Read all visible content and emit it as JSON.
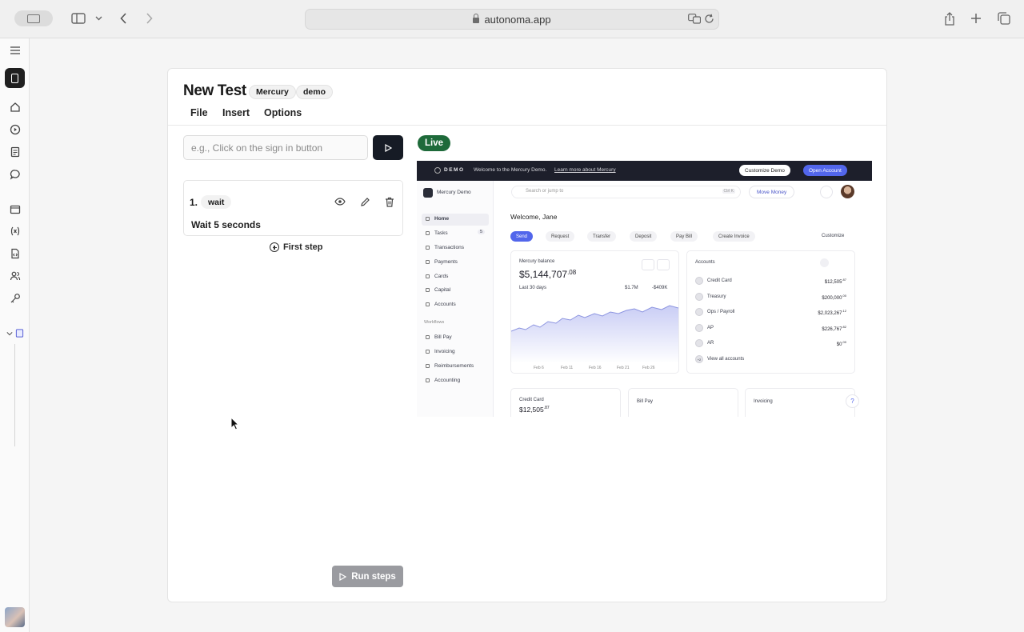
{
  "browser": {
    "url": "autonoma.app"
  },
  "test": {
    "title": "New Test",
    "tags": [
      "Mercury",
      "demo"
    ],
    "menu": [
      "File",
      "Insert",
      "Options"
    ],
    "prompt_placeholder": "e.g., Click on the sign in button",
    "steps": [
      {
        "number": "1.",
        "action": "wait",
        "description": "Wait 5 seconds"
      }
    ],
    "first_step_label": "First step",
    "run_label": "Run steps",
    "live_label": "Live"
  },
  "preview": {
    "banner": {
      "brand": "DEMO",
      "welcome": "Welcome to the Mercury Demo.",
      "link": "Learn more about Mercury",
      "customize": "Customize Demo",
      "open": "Open Account"
    },
    "org": "Mercury Demo",
    "search_placeholder": "Search or jump to",
    "search_hint": "Ctrl K",
    "move_money": "Move Money",
    "nav": [
      "Home",
      "Tasks",
      "Transactions",
      "Payments",
      "Cards",
      "Capital",
      "Accounts"
    ],
    "tasks_count": "5",
    "workflows_label": "Workflows",
    "workflows": [
      "Bill Pay",
      "Invoicing",
      "Reimbursements",
      "Accounting"
    ],
    "greeting": "Welcome, Jane",
    "actions": [
      "Send",
      "Request",
      "Transfer",
      "Deposit",
      "Pay Bill",
      "Create Invoice"
    ],
    "customize": "Customize",
    "balance": {
      "label": "Mercury balance",
      "amount": "$5,144,707",
      "cents": ".08",
      "period": "Last 30 days",
      "in": "$1.7M",
      "out": "-$409K",
      "x_ticks": [
        "Feb 6",
        "Feb 11",
        "Feb 16",
        "Feb 21",
        "Feb 26"
      ]
    },
    "accounts": {
      "title": "Accounts",
      "rows": [
        {
          "name": "Credit Card",
          "amount": "$12,505",
          "cents": ".87"
        },
        {
          "name": "Treasury",
          "amount": "$200,000",
          "cents": ".00"
        },
        {
          "name": "Ops / Payroll",
          "amount": "$2,023,267",
          "cents": ".12"
        },
        {
          "name": "AP",
          "amount": "$226,767",
          "cents": ".82"
        },
        {
          "name": "AR",
          "amount": "$0",
          "cents": ".00"
        }
      ],
      "more_count": "+2",
      "view_all": "View all accounts"
    },
    "bottom_cards": [
      {
        "title": "Credit Card",
        "amount": "$12,505",
        "cents": ".87"
      },
      {
        "title": "Bill Pay"
      },
      {
        "title": "Invoicing"
      }
    ],
    "help": "?"
  }
}
